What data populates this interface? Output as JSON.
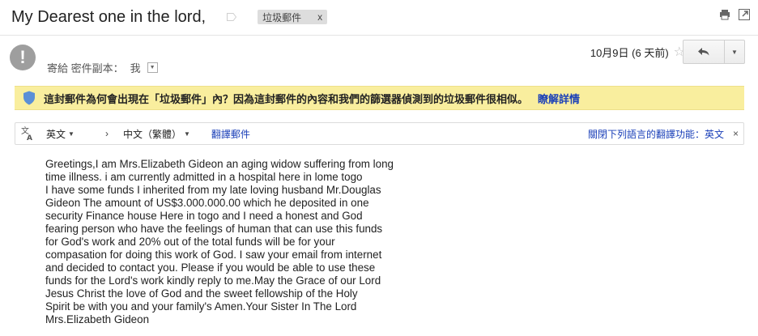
{
  "subject": "My Dearest one in the lord,",
  "label_chip": {
    "text": "垃圾郵件",
    "close": "x"
  },
  "toolbar_icons": [
    "print-icon",
    "new-window-icon"
  ],
  "sender": {
    "avatar_glyph": "!",
    "recipients_label": "寄給 密件副本：",
    "recipient": "我"
  },
  "date": {
    "text": "10月9日 (6 天前)"
  },
  "spam_banner": {
    "message": "這封郵件為何會出現在「垃圾郵件」內？因為這封郵件的內容和我們的篩選器偵測到的垃圾郵件很相似。",
    "learn_more": "瞭解詳情"
  },
  "translate_bar": {
    "source_lang": "英文",
    "arrow": "›",
    "target_lang": "中文（繁體）",
    "translate_link": "翻譯郵件",
    "turn_off": "關閉下列語言的翻譯功能：英文",
    "close": "×"
  },
  "body_lines": [
    "Greetings,I am Mrs.Elizabeth Gideon an aging widow suffering from long",
    "time illness. i am currently admitted in a hospital here in lome togo",
    "I have some funds I inherited from my late loving husband Mr.Douglas",
    "Gideon The amount of US$3.000.000.00 which he deposited in one",
    "security Finance house Here in togo and I need a honest and God",
    "fearing person who have the feelings of human that can use this funds",
    "for God's work and 20% out of the total funds will be for your",
    "compasation for doing this work of God. I saw your email from internet",
    "and decided to contact you. Please if you would be able to use these",
    "funds for the Lord's work kindly reply to me.May the Grace of our Lord",
    "Jesus Christ the love of God and the sweet fellowship of the Holy",
    "Spirit be with you and your family's Amen.Your Sister In The Lord",
    "Mrs.Elizabeth Gideon"
  ],
  "colors": {
    "banner_bg": "#f9ee9e",
    "link": "#1a3fb8",
    "avatar": "#9e9e9e",
    "shield": "#5b8fd6"
  }
}
